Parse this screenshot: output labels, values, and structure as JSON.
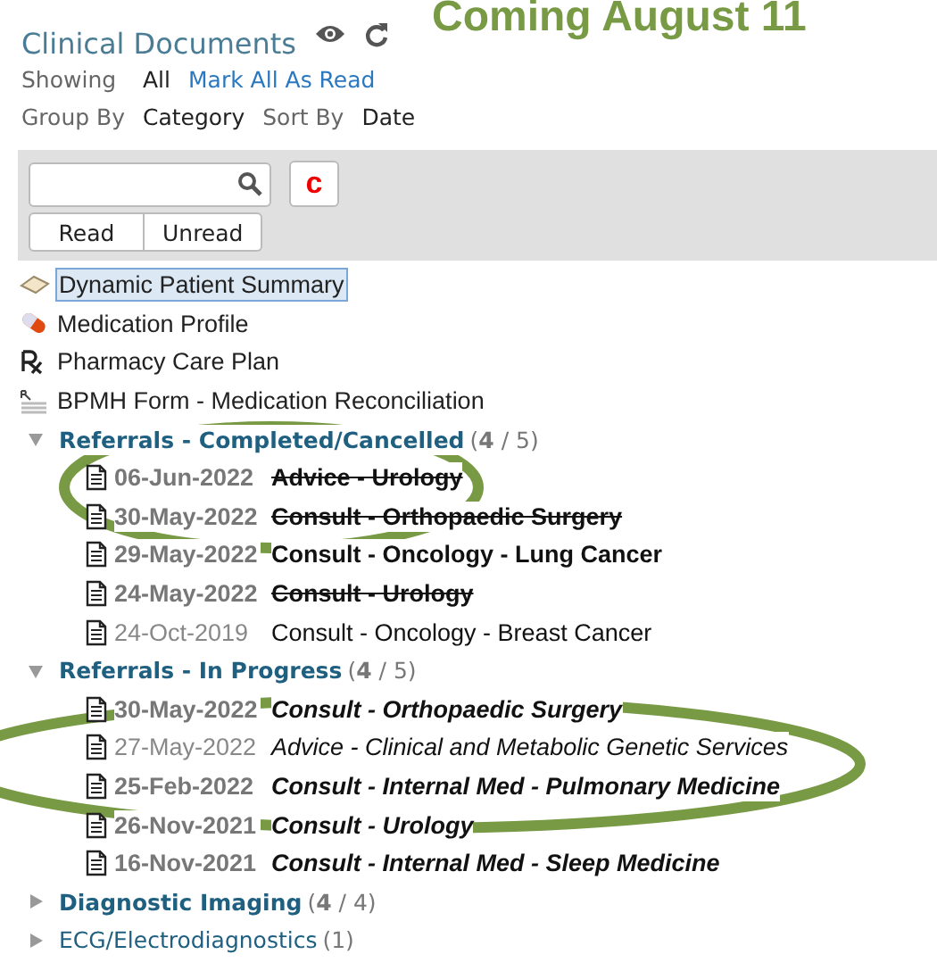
{
  "banner": "Coming August 11",
  "header": {
    "title": "Clinical Documents"
  },
  "filters": {
    "showing_label": "Showing",
    "showing_value": "All",
    "mark_all_link": "Mark All As Read",
    "group_label": "Group By",
    "group_value": "Category",
    "sort_label": "Sort By",
    "sort_value": "Date"
  },
  "toolbar": {
    "c_button": "c",
    "buttons": [
      "Read",
      "Unread"
    ]
  },
  "items": [
    {
      "kind": "summary",
      "label": "Dynamic Patient Summary",
      "selected": true
    },
    {
      "kind": "pill",
      "label": "Medication Profile",
      "selected": false
    },
    {
      "kind": "rx",
      "label": "Pharmacy Care Plan",
      "selected": false
    },
    {
      "kind": "form",
      "label": "BPMH Form - Medication Reconciliation",
      "selected": false
    }
  ],
  "groups": [
    {
      "label": "Referrals - Completed/Cancelled",
      "expanded": true,
      "has_unread": true,
      "count": "(**4** / 5)",
      "children": [
        {
          "date": "06-Jun-2022",
          "title": "Advice - Urology",
          "read": false,
          "struck": true,
          "italic": false
        },
        {
          "date": "30-May-2022",
          "title": "Consult - Orthopaedic Surgery",
          "read": false,
          "struck": true,
          "italic": false
        },
        {
          "date": "29-May-2022",
          "title": "Consult - Oncology - Lung Cancer",
          "read": false,
          "struck": false,
          "italic": false
        },
        {
          "date": "24-May-2022",
          "title": "Consult - Urology",
          "read": false,
          "struck": true,
          "italic": false
        },
        {
          "date": "24-Oct-2019",
          "title": "Consult - Oncology - Breast Cancer",
          "read": true,
          "struck": false,
          "italic": false
        }
      ]
    },
    {
      "label": "Referrals - In Progress",
      "expanded": true,
      "has_unread": true,
      "count": "(**4** / 5)",
      "children": [
        {
          "date": "30-May-2022",
          "title": "Consult - Orthopaedic Surgery",
          "read": false,
          "struck": false,
          "italic": true
        },
        {
          "date": "27-May-2022",
          "title": "Advice - Clinical and Metabolic Genetic Services",
          "read": true,
          "struck": false,
          "italic": true
        },
        {
          "date": "25-Feb-2022",
          "title": "Consult - Internal Med - Pulmonary Medicine",
          "read": false,
          "struck": false,
          "italic": true
        },
        {
          "date": "26-Nov-2021",
          "title": "Consult - Urology",
          "read": false,
          "struck": false,
          "italic": true
        },
        {
          "date": "16-Nov-2021",
          "title": "Consult - Internal Med - Sleep Medicine",
          "read": false,
          "struck": false,
          "italic": true
        }
      ]
    },
    {
      "label": "Diagnostic Imaging",
      "expanded": false,
      "has_unread": true,
      "count": "(**4** / 4)"
    },
    {
      "label": "ECG/Electrodiagnostics",
      "expanded": false,
      "has_unread": false,
      "count": "(1)"
    }
  ]
}
